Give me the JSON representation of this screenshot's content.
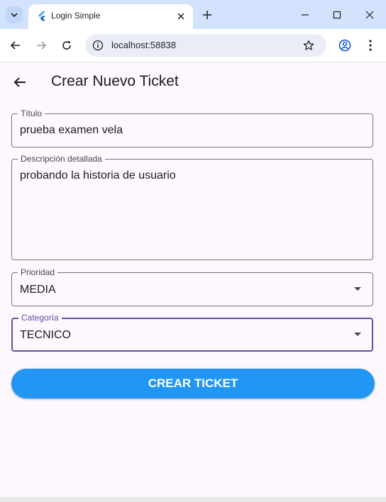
{
  "browser": {
    "tab_title": "Login Simple",
    "url": "localhost:58838"
  },
  "app": {
    "title": "Crear Nuevo Ticket",
    "fields": {
      "titulo": {
        "label": "Título",
        "value": "prueba examen vela"
      },
      "descripcion": {
        "label": "Descripción detallada",
        "value": "probando la historia de usuario"
      },
      "prioridad": {
        "label": "Prioridad",
        "value": "MEDIA"
      },
      "categoria": {
        "label": "Categoría",
        "value": "TECNICO"
      }
    },
    "submit_label": "CREAR TICKET"
  },
  "colors": {
    "accent": "#6750a4",
    "button": "#2196f3",
    "background": "#fdf7fe",
    "tabstrip": "#d3e3fd"
  }
}
